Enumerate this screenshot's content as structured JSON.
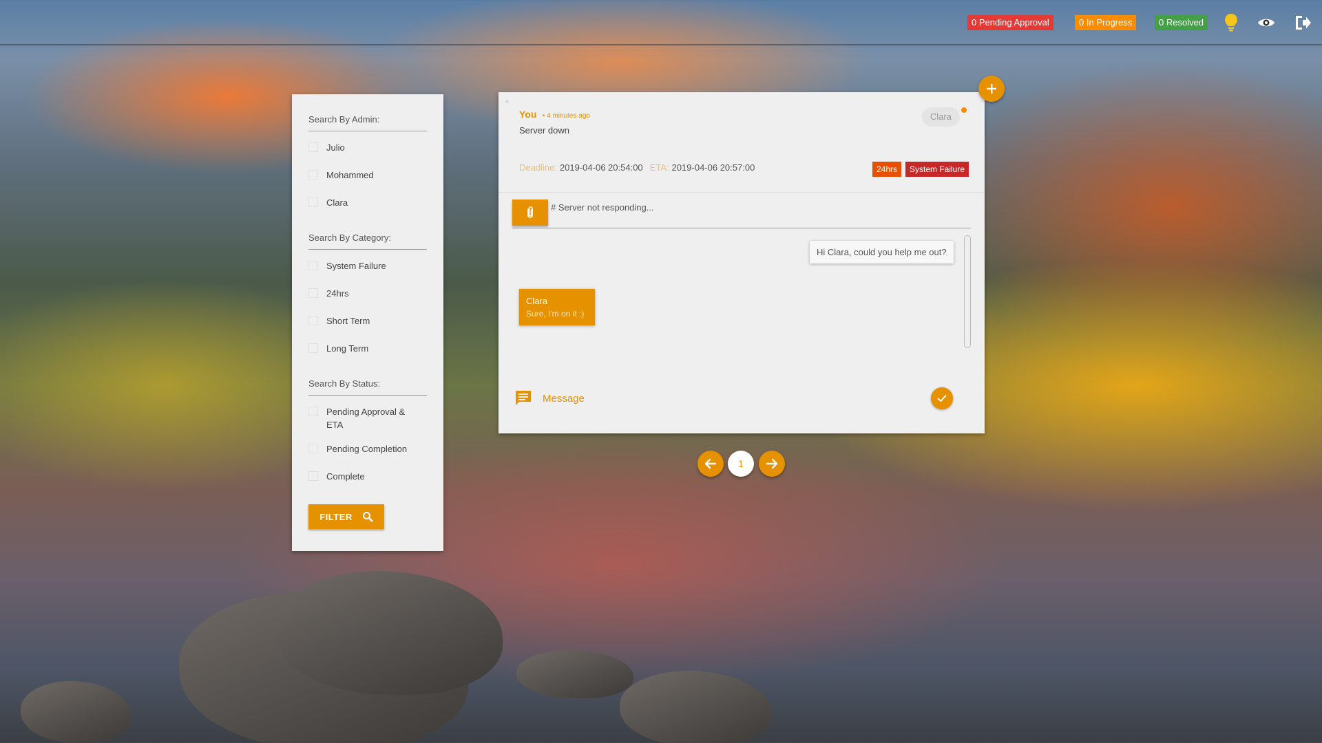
{
  "colors": {
    "accent": "#e69100",
    "pending_badge": "#e53935",
    "progress_badge": "#fb8c00",
    "resolved_badge": "#43a047",
    "tag_24hrs": "#e65100",
    "tag_system_failure": "#c62828"
  },
  "topbar": {
    "pending_label": "0 Pending Approval",
    "in_progress_label": "0 In Progress",
    "resolved_label": "0 Resolved",
    "icons": [
      "lightbulb-icon",
      "eye-icon",
      "logout-icon"
    ]
  },
  "filters": {
    "admin_title": "Search By Admin:",
    "admins": [
      "Julio",
      "Mohammed",
      "Clara"
    ],
    "category_title": "Search By Category:",
    "categories": [
      "System Failure",
      "24hrs",
      "Short Term",
      "Long Term"
    ],
    "status_title": "Search By Status:",
    "statuses": [
      "Pending Approval & ETA",
      "Pending Completion",
      "Complete"
    ],
    "filter_button": "FILTER"
  },
  "ticket": {
    "author": "You",
    "time_ago": "• 4 minutes ago",
    "subject": "Server down",
    "assigned_admin": "Clara",
    "deadline_label": "Deadline:",
    "deadline": "2019-04-06 20:54:00",
    "eta_label": "ETA:",
    "eta": "2019-04-06 20:57:00",
    "tags": [
      "24hrs",
      "System Failure"
    ],
    "description": "# Server not responding...",
    "collapse_mark": "«",
    "messages": [
      {
        "side": "right",
        "text": "Hi Clara, could you help me out?"
      },
      {
        "side": "left",
        "name": "Clara",
        "text": "Sure, I'm on it :)"
      }
    ],
    "message_placeholder": "Message"
  },
  "pagination": {
    "current_page": "1"
  }
}
